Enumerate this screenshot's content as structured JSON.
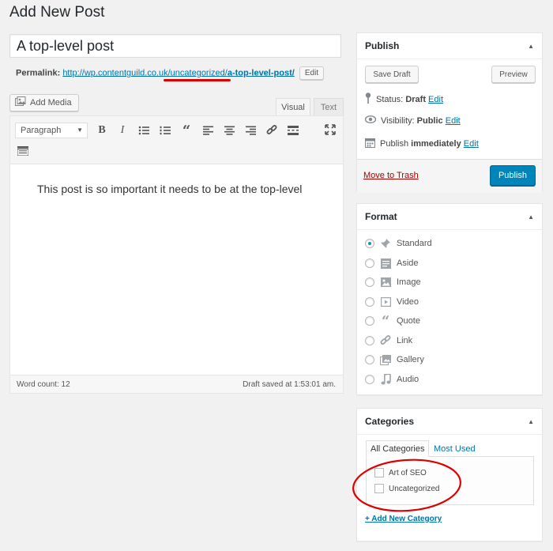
{
  "page": {
    "title": "Add New Post"
  },
  "post": {
    "title_value": "A top-level post",
    "permalink_label": "Permalink:",
    "permalink_base": "http://wp.contentguild.co.uk/uncategorized/",
    "permalink_slug": "a-top-level-post/",
    "permalink_edit": "Edit"
  },
  "editor": {
    "add_media": "Add Media",
    "tab_visual": "Visual",
    "tab_text": "Text",
    "format_select": "Paragraph",
    "content": "This post is so important it needs to be at the top-level",
    "word_count": "Word count: 12",
    "draft_saved": "Draft saved at 1:53:01 am.",
    "toolbar_icons": [
      "bold-icon",
      "italic-icon",
      "bullet-list-icon",
      "numbered-list-icon",
      "blockquote-icon",
      "align-left-icon",
      "align-center-icon",
      "align-right-icon",
      "link-icon",
      "read-more-icon",
      "fullscreen-icon",
      "toolbar-toggle-icon"
    ]
  },
  "publish": {
    "title": "Publish",
    "save_draft": "Save Draft",
    "preview": "Preview",
    "status_label": "Status:",
    "status_value": "Draft",
    "status_edit": "Edit",
    "visibility_label": "Visibility:",
    "visibility_value": "Public",
    "visibility_edit": "Edit",
    "schedule_label": "Publish",
    "schedule_value": "immediately",
    "schedule_edit": "Edit",
    "trash": "Move to Trash",
    "publish_button": "Publish"
  },
  "format": {
    "title": "Format",
    "selected": "Standard",
    "options": [
      {
        "label": "Standard",
        "icon": "pin-icon"
      },
      {
        "label": "Aside",
        "icon": "aside-icon"
      },
      {
        "label": "Image",
        "icon": "image-icon"
      },
      {
        "label": "Video",
        "icon": "video-icon"
      },
      {
        "label": "Quote",
        "icon": "quote-icon"
      },
      {
        "label": "Link",
        "icon": "link-icon"
      },
      {
        "label": "Gallery",
        "icon": "gallery-icon"
      },
      {
        "label": "Audio",
        "icon": "audio-icon"
      }
    ]
  },
  "categories": {
    "title": "Categories",
    "tab_all": "All Categories",
    "tab_used": "Most Used",
    "items": [
      {
        "label": "Art of SEO",
        "checked": false
      },
      {
        "label": "Uncategorized",
        "checked": false
      }
    ],
    "add_new": "+ Add New Category"
  },
  "colors": {
    "accent": "#0085ba",
    "link": "#0073aa",
    "trash": "#a00000",
    "annotation": "#dd0000"
  }
}
